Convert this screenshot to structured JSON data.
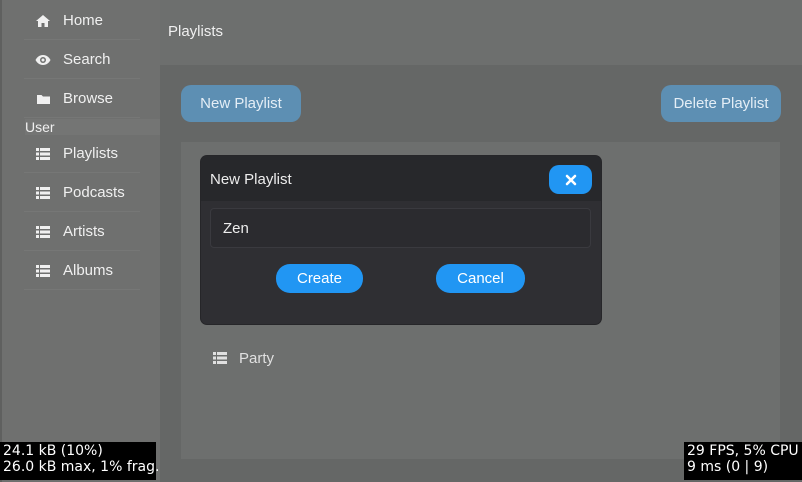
{
  "sidebar": {
    "items": [
      {
        "label": "Home",
        "icon": "home-icon"
      },
      {
        "label": "Search",
        "icon": "eye-icon"
      },
      {
        "label": "Browse",
        "icon": "folder-icon"
      }
    ],
    "section_label": "User",
    "user_items": [
      {
        "label": "Playlists",
        "icon": "list-icon"
      },
      {
        "label": "Podcasts",
        "icon": "list-icon"
      },
      {
        "label": "Artists",
        "icon": "list-icon"
      },
      {
        "label": "Albums",
        "icon": "list-icon"
      }
    ]
  },
  "main": {
    "title": "Playlists",
    "new_playlist_label": "New Playlist",
    "delete_playlist_label": "Delete Playlist",
    "playlists": [
      {
        "label": "Party",
        "icon": "list-icon"
      }
    ]
  },
  "dialog": {
    "title": "New Playlist",
    "name_value": "Zen",
    "create_label": "Create",
    "cancel_label": "Cancel",
    "close_icon": "close-icon"
  },
  "stats": {
    "mem_line1": "24.1 kB (10%)",
    "mem_line2": "26.0 kB max, 1% frag.",
    "perf_line1": "29 FPS, 5% CPU",
    "perf_line2": "9 ms (0 | 9)"
  },
  "colors": {
    "accent": "#2196f3",
    "accent_dimmed": "#5d8fb3",
    "dialog_bg": "#2f2f33"
  }
}
